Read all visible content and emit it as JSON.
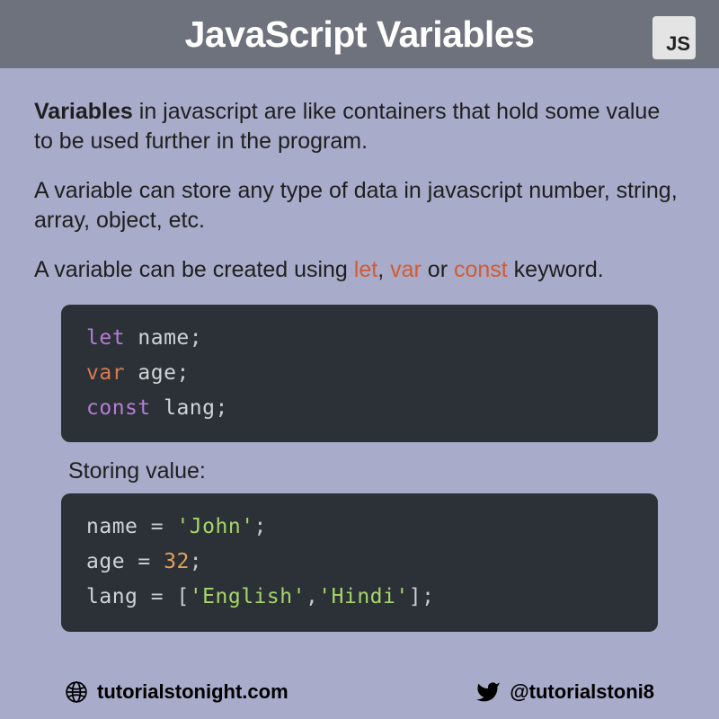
{
  "header": {
    "title": "JavaScript Variables",
    "badge": "JS"
  },
  "paragraphs": {
    "p1_bold": "Variables",
    "p1_rest": " in javascript are like containers that hold some value to be used further in the program.",
    "p2": "A variable can store any type of data in javascript number, string, array, object, etc.",
    "p3_a": "A variable can be created using ",
    "p3_kw1": "let",
    "p3_b": ", ",
    "p3_kw2": "var",
    "p3_c": " or ",
    "p3_kw3": "const",
    "p3_d": " keyword."
  },
  "code1": {
    "l1_kw": "let",
    "l1_id": " name",
    "l1_p": ";",
    "l2_kw": "var",
    "l2_id": " age",
    "l2_p": ";",
    "l3_kw": "const",
    "l3_id": " lang",
    "l3_p": ";"
  },
  "subheading": "Storing value:",
  "code2": {
    "l1_id": "name ",
    "l1_eq": "= ",
    "l1_str": "'John'",
    "l1_p": ";",
    "l2_id": "age ",
    "l2_eq": "= ",
    "l2_num": "32",
    "l2_p": ";",
    "l3_id": "lang ",
    "l3_eq": "= ",
    "l3_b1": "[",
    "l3_s1": "'English'",
    "l3_c": ",",
    "l3_s2": "'Hindi'",
    "l3_b2": "]",
    "l3_p": ";"
  },
  "footer": {
    "website": "tutorialstonight.com",
    "twitter": "@tutorialstoni8"
  }
}
